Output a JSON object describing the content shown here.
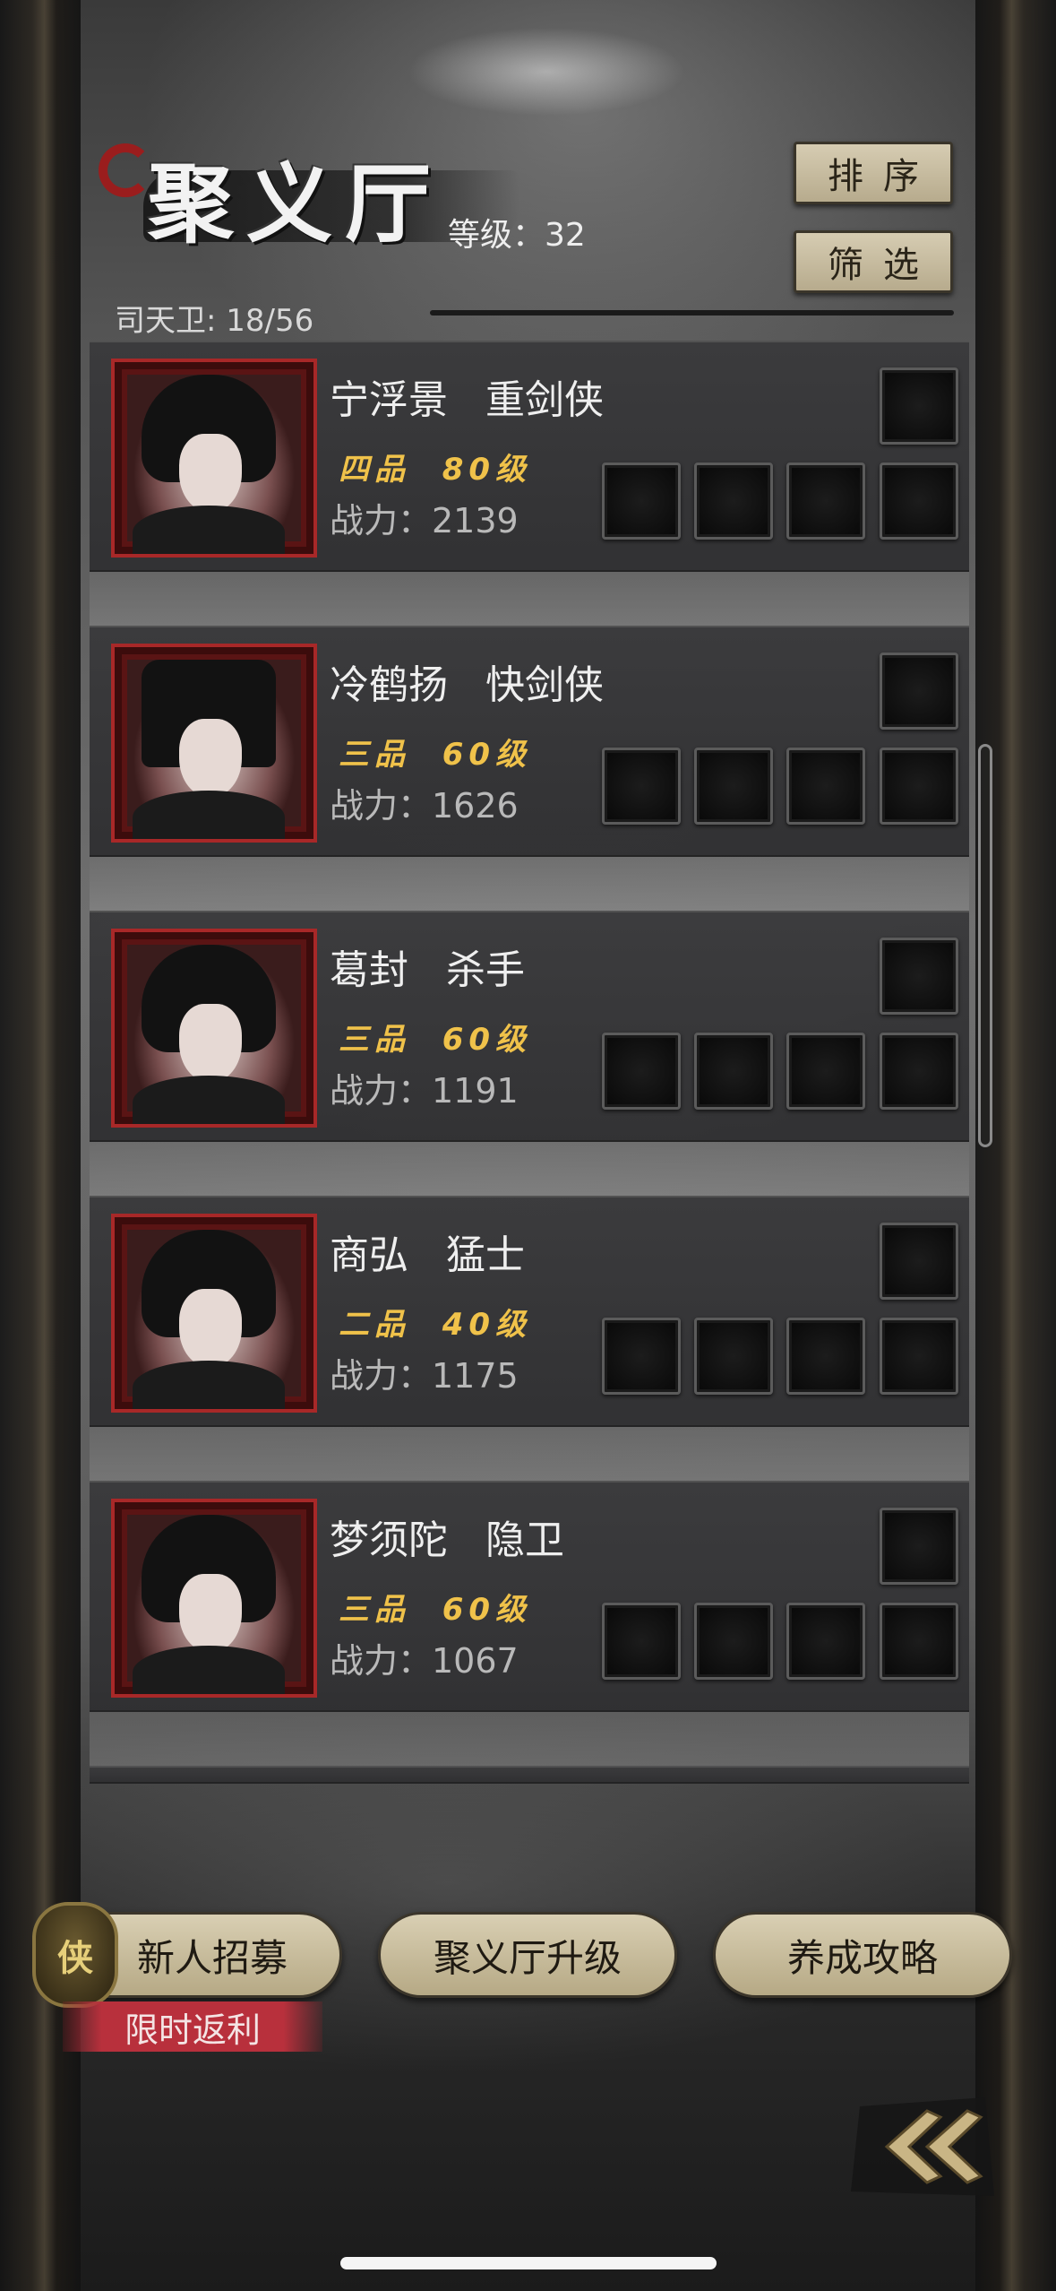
{
  "header": {
    "title": "聚义厅",
    "level_text": "等级：32",
    "guard_count": "司天卫: 18/56",
    "sort_label": "排序",
    "filter_label": "筛选"
  },
  "heroes": [
    {
      "name": "宁浮景",
      "class": "重剑侠",
      "grade": "四品",
      "level": "80级",
      "power": "战力：2139"
    },
    {
      "name": "冷鹤扬",
      "class": "快剑侠",
      "grade": "三品",
      "level": "60级",
      "power": "战力：1626"
    },
    {
      "name": "葛封",
      "class": "杀手",
      "grade": "三品",
      "level": "60级",
      "power": "战力：1191"
    },
    {
      "name": "商弘",
      "class": "猛士",
      "grade": "二品",
      "level": "40级",
      "power": "战力：1175"
    },
    {
      "name": "梦须陀",
      "class": "隐卫",
      "grade": "三品",
      "level": "60级",
      "power": "战力：1067"
    }
  ],
  "footer": {
    "recruit_label": "新人招募",
    "recruit_badge": "侠",
    "promo_label": "限时返利",
    "upgrade_label": "聚义厅升级",
    "guide_label": "养成攻略"
  },
  "icons": {
    "back": "double-chevron-left-icon"
  },
  "colors": {
    "gold": "#f0c24a",
    "portrait_border": "#a82828",
    "button_beige": "#d6ccb2",
    "promo_red": "#b8303c"
  }
}
